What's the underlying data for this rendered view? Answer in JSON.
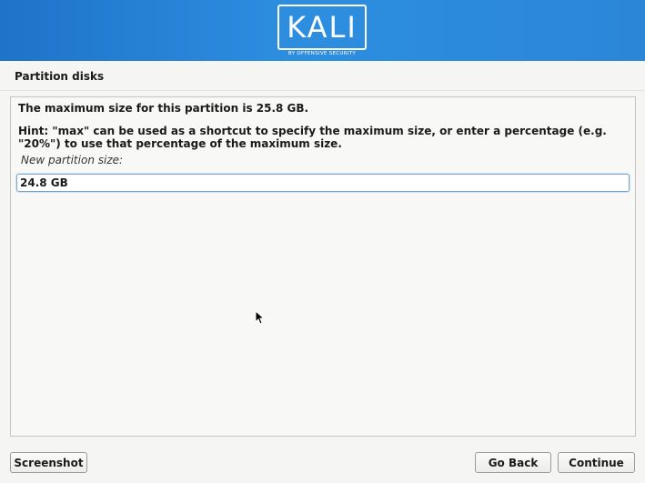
{
  "banner": {
    "logo_text": "KALI",
    "logo_subtext": "BY OFFENSIVE SECURITY"
  },
  "section": {
    "title": "Partition disks"
  },
  "panel": {
    "max_size_text": "The maximum size for this partition is 25.8 GB.",
    "hint_text": "Hint: \"max\" can be used as a shortcut to specify the maximum size, or enter a percentage (e.g. \"20%\") to use that percentage of the maximum size.",
    "field_label": "New partition size:",
    "field_value": "24.8 GB"
  },
  "buttons": {
    "screenshot": "Screenshot",
    "go_back": "Go Back",
    "continue": "Continue"
  },
  "colors": {
    "banner": "#2d8ee0",
    "background": "#f5f6f4",
    "input_border": "#7aa6cf"
  }
}
